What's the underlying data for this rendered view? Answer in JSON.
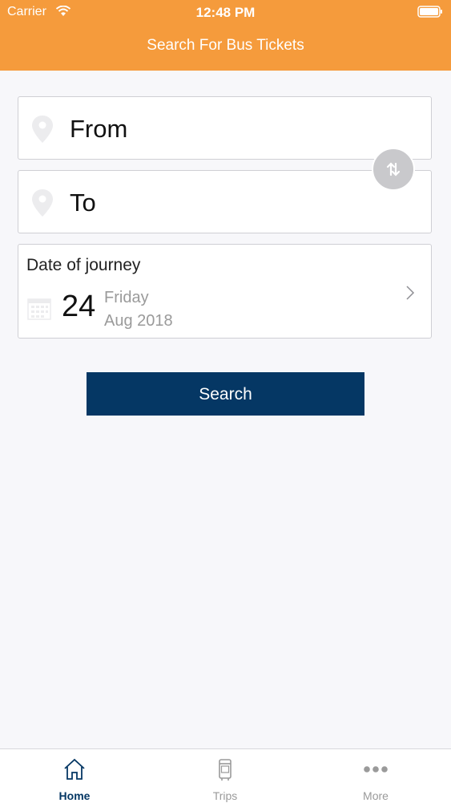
{
  "status_bar": {
    "carrier": "Carrier",
    "time": "12:48 PM"
  },
  "header": {
    "title": "Search For Bus Tickets"
  },
  "from_field": {
    "placeholder": "From",
    "icon": "map-pin-icon"
  },
  "to_field": {
    "placeholder": "To",
    "icon": "map-pin-icon"
  },
  "swap_button": {
    "icon": "swap-arrows-icon"
  },
  "date_of_journey": {
    "label": "Date of journey",
    "day": "24",
    "weekday": "Friday",
    "month_year": "Aug 2018"
  },
  "search_button": {
    "label": "Search"
  },
  "tabs": [
    {
      "label": "Home",
      "icon": "home-icon",
      "active": true
    },
    {
      "label": "Trips",
      "icon": "bus-icon",
      "active": false
    },
    {
      "label": "More",
      "icon": "more-dots-icon",
      "active": false
    }
  ],
  "colors": {
    "header": "#f59b3c",
    "primary": "#053764",
    "background": "#f7f7fa"
  }
}
